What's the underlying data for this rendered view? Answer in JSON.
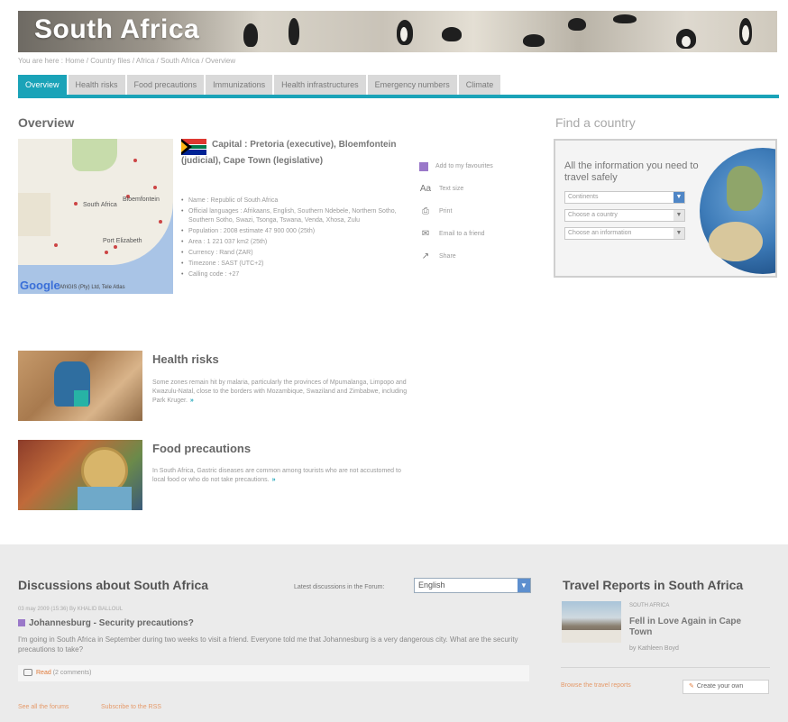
{
  "banner": {
    "title": "South Africa"
  },
  "breadcrumb": "You are here : Home / Country files / Africa / South Africa / Overview",
  "tabs": [
    {
      "label": "Overview",
      "active": true
    },
    {
      "label": "Health risks"
    },
    {
      "label": "Food precautions"
    },
    {
      "label": "Immunizations"
    },
    {
      "label": "Health infrastructures"
    },
    {
      "label": "Emergency numbers"
    },
    {
      "label": "Climate"
    }
  ],
  "overview": {
    "title": "Overview",
    "map": {
      "labels": [
        "South Africa",
        "Bloemfontein",
        "Port Elizabeth"
      ],
      "logo": "Google",
      "credit": "AfriGIS (Pty) Ltd, Tele Atlas"
    },
    "capital": "Capital : Pretoria (executive), Bloemfontein (judicial), Cape Town (legislative)",
    "facts": [
      "Name : Republic of South Africa",
      "Official languages : Afrikaans, English, Southern Ndebele, Northern Sotho, Southern Sotho, Swazi, Tsonga, Tswana, Venda, Xhosa, Zulu",
      "Population : 2008 estimate 47 900 000 (25th)",
      "Area : 1 221 037 km2 (25th)",
      "Currency : Rand (ZAR)",
      "Timezone : SAST (UTC+2)",
      "Calling code : +27"
    ],
    "actions": [
      {
        "label": "Add to my favourites",
        "icon": "favourite-icon"
      },
      {
        "label": "Text size",
        "icon": "text-size-icon"
      },
      {
        "label": "Print",
        "icon": "print-icon"
      },
      {
        "label": "Email to a friend",
        "icon": "email-icon"
      },
      {
        "label": "Share",
        "icon": "share-icon"
      }
    ]
  },
  "find": {
    "title": "Find a country",
    "text": "All the information you need to travel safely",
    "continent": "Continents",
    "country": "Choose a country",
    "info": "Choose an information"
  },
  "articles": [
    {
      "title": "Health risks",
      "text": "Some zones remain hit by malaria, particularly the provinces of Mpumalanga, Limpopo and Kwazulu-Natal, close to the borders with Mozambique, Swaziland and Zimbabwe, including Park Kruger."
    },
    {
      "title": "Food precautions",
      "text": "In South Africa, Gastric diseases are common among tourists who are not accustomed to local food or who do not take precautions."
    }
  ],
  "discussions": {
    "title": "Discussions about South Africa",
    "latest_label": "Latest discussions in the Forum:",
    "language": "English",
    "post_date": "03 may 2009 (15:36) By KHALID BALLOUL",
    "post_title": "Johannesburg - Security precautions?",
    "post_text": "I'm going in South Africa in September during two weeks to visit a friend. Everyone told me that Johannesburg is a very dangerous city. What are the security precautions to take?",
    "read": "Read",
    "comments": "(2 comments)",
    "see_all": "See all the forums",
    "subscribe": "Subscribe to the RSS"
  },
  "travel_reports": {
    "title": "Travel Reports in South Africa",
    "kicker": "SOUTH AFRICA",
    "headline": "Fell in Love Again in Cape Town",
    "author": "by Kathleen Boyd",
    "browse": "Browse the travel reports",
    "create": "Create your own"
  },
  "colors": {
    "accent": "#1aa3b8",
    "link": "#e59a6a",
    "tab_inactive": "#d9d9d9"
  }
}
